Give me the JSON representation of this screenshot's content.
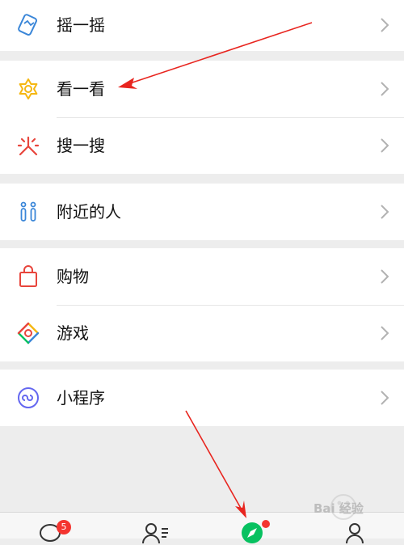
{
  "menu": {
    "shake": "摇一摇",
    "top_stories": "看一看",
    "search": "搜一搜",
    "people_nearby": "附近的人",
    "shopping": "购物",
    "games": "游戏",
    "mini_programs": "小程序"
  },
  "tabbar": {
    "chats_badge": "5"
  },
  "watermark": {
    "text": "Bai 经验"
  },
  "colors": {
    "background": "#ededed",
    "row_background": "#ffffff",
    "arrow": "#e8251f",
    "badge": "#f43530",
    "discover_green": "#07c160"
  }
}
